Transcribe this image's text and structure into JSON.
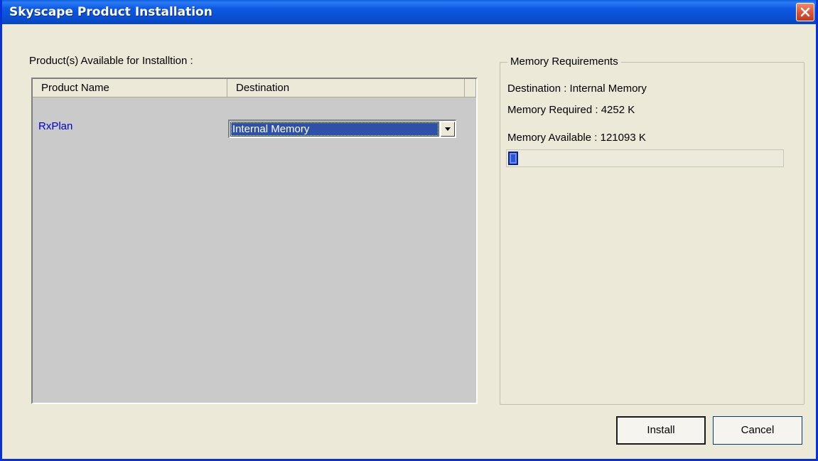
{
  "window": {
    "title": "Skyscape Product Installation"
  },
  "products_panel": {
    "label": "Product(s) Available for Installtion :",
    "columns": [
      "Product Name",
      "Destination"
    ],
    "rows": [
      {
        "name": "RxPlan",
        "destination": "Internal Memory"
      }
    ]
  },
  "memory": {
    "group_title": "Memory Requirements",
    "destination": "Destination : Internal Memory",
    "required": "Memory Required : 4252 K",
    "available": "Memory Available : 121093 K",
    "usage_fraction": 0.035
  },
  "buttons": {
    "install": "Install",
    "cancel": "Cancel"
  },
  "colors": {
    "titlebar": "#0a4ed0",
    "window_bg": "#ece9d8",
    "list_bg": "#cacaca",
    "product_link": "#0000cc",
    "selection": "#2f50a8",
    "progress": "#2b55d8"
  },
  "icons": {
    "close": "close-icon",
    "dropdown": "chevron-down-icon"
  }
}
